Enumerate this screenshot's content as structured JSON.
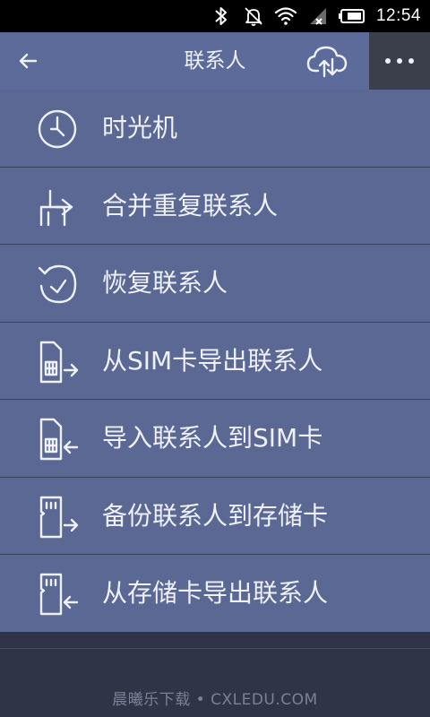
{
  "status_bar": {
    "time": "12:54",
    "icons": [
      "bluetooth-icon",
      "notifications-off-icon",
      "wifi-icon",
      "signal-icon",
      "battery-icon"
    ]
  },
  "app_bar": {
    "title": "联系人",
    "back_icon": "arrow-left-icon",
    "cloud_icon": "cloud-sync-icon",
    "more_icon": "more-horizontal-icon"
  },
  "menu": {
    "items": [
      {
        "label": "时光机",
        "icon": "clock-icon"
      },
      {
        "label": "合并重复联系人",
        "icon": "merge-icon"
      },
      {
        "label": "恢复联系人",
        "icon": "restore-icon"
      },
      {
        "label": "从SIM卡导出联系人",
        "icon": "sim-export-icon"
      },
      {
        "label": "导入联系人到SIM卡",
        "icon": "sim-import-icon"
      },
      {
        "label": "备份联系人到存储卡",
        "icon": "sdcard-backup-icon"
      },
      {
        "label": "从存储卡导出联系人",
        "icon": "sdcard-export-icon"
      }
    ]
  },
  "watermark": "晨曦乐下载 • CXLEDU.COM",
  "colors": {
    "status_bar": "#000000",
    "app_bar": "#5c6b99",
    "more_button_bg": "#3b3f4c",
    "menu_bg": "#5b6894",
    "menu_divider": "#3b4260",
    "text": "#eef1fb",
    "page_bg": "#2f3446",
    "watermark_text": "#7b8196"
  }
}
